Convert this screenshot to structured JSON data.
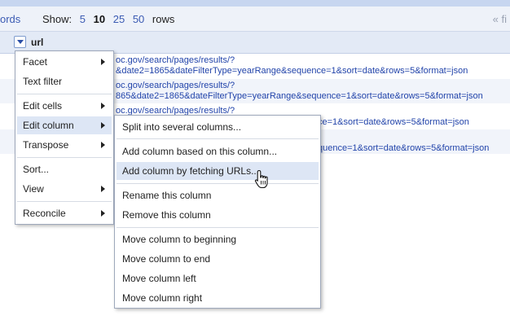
{
  "view_bar": {
    "left_fragment": "ords",
    "show_label": "Show:",
    "page_sizes": [
      "5",
      "10",
      "25",
      "50"
    ],
    "current_page_size": "10",
    "rows_label": "rows",
    "pager_fragment": "« fi"
  },
  "column": {
    "name": "url"
  },
  "rows": [
    {
      "line1": "oc.gov/search/pages/results/?",
      "line2": "&date2=1865&dateFilterType=yearRange&sequence=1&sort=date&rows=5&format=json"
    },
    {
      "line1": "oc.gov/search/pages/results/?",
      "line2": "865&date2=1865&dateFilterType=yearRange&sequence=1&sort=date&rows=5&format=json"
    },
    {
      "line1": "oc.gov/search/pages/results/?",
      "line2": "ce=1&sort=date&rows=5&format=json"
    },
    {
      "line1": "",
      "line2": "quence=1&sort=date&rows=5&format=json"
    }
  ],
  "left_fragment": "on",
  "main_menu": {
    "items": [
      {
        "label": "Facet",
        "submenu": true
      },
      {
        "label": "Text filter",
        "submenu": false
      },
      {
        "label": "Edit cells",
        "submenu": true
      },
      {
        "label": "Edit column",
        "submenu": true,
        "active": true
      },
      {
        "label": "Transpose",
        "submenu": true
      },
      {
        "label": "Sort...",
        "submenu": false
      },
      {
        "label": "View",
        "submenu": true
      },
      {
        "label": "Reconcile",
        "submenu": true
      }
    ]
  },
  "edit_column_menu": {
    "items": [
      {
        "label": "Split into several columns..."
      },
      {
        "label": "Add column based on this column..."
      },
      {
        "label": "Add column by fetching URLs...",
        "hovered": true
      },
      {
        "label": "Rename this column"
      },
      {
        "label": "Remove this column"
      },
      {
        "label": "Move column to beginning"
      },
      {
        "label": "Move column to end"
      },
      {
        "label": "Move column left"
      },
      {
        "label": "Move column right"
      }
    ]
  },
  "icons": {
    "column_dropdown": "chevron-down-icon",
    "submenu": "chevron-right-icon",
    "cursor": "hand-pointer-icon"
  },
  "colors": {
    "link": "#3b5bb3",
    "header_bg": "#e3eaf6",
    "menu_highlight": "#dde6f5"
  }
}
